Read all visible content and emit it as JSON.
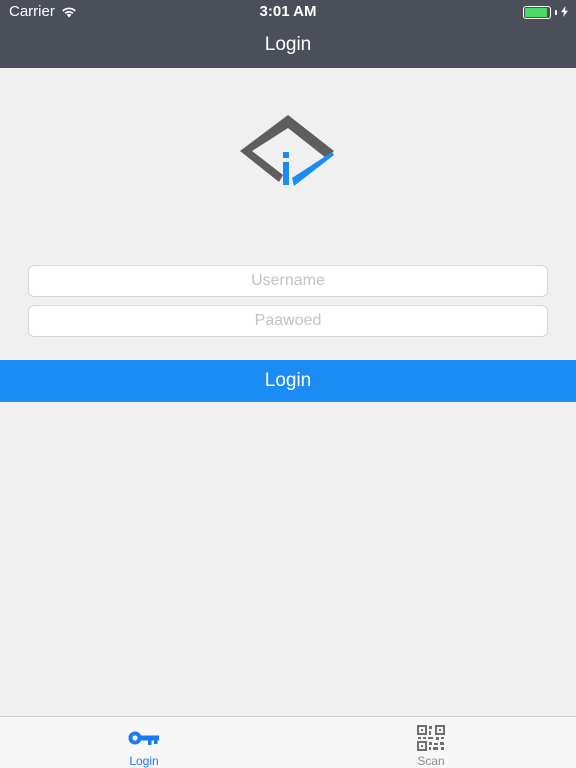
{
  "status_bar": {
    "carrier": "Carrier",
    "time": "3:01 AM",
    "wifi_icon": "wifi-icon",
    "battery_icon": "battery-icon",
    "charging_icon": "charging-bolt-icon",
    "battery_level": 0.9,
    "battery_color": "#4cd964"
  },
  "nav": {
    "title": "Login"
  },
  "logo": {
    "icon": "app-logo-icon",
    "colors": {
      "gray": "#5e5e5e",
      "blue": "#1a8cf4"
    }
  },
  "form": {
    "username": {
      "placeholder": "Username",
      "value": ""
    },
    "password": {
      "placeholder": "Paawoed",
      "value": ""
    },
    "submit_label": "Login"
  },
  "tab_bar": {
    "tabs": [
      {
        "label": "Login",
        "icon": "key-icon",
        "active": true,
        "color": "#1a7cf4"
      },
      {
        "label": "Scan",
        "icon": "qr-code-icon",
        "active": false,
        "color": "#8e8e93"
      }
    ]
  },
  "colors": {
    "header_bg": "#4a4f5a",
    "background": "#f0f0f0",
    "accent": "#1a8cf4"
  }
}
